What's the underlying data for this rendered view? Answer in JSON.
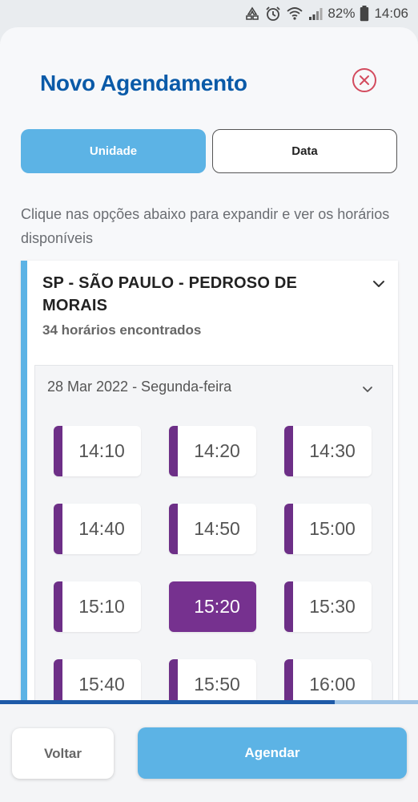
{
  "status_bar": {
    "battery": "82%",
    "time": "14:06",
    "icons": [
      "recycle-icon",
      "alarm-icon",
      "wifi-icon",
      "signal-icon",
      "battery-icon"
    ]
  },
  "header": {
    "title": "Novo Agendamento",
    "close_icon": "close-circle-icon"
  },
  "tabs": [
    {
      "label": "Unidade",
      "active": true
    },
    {
      "label": "Data",
      "active": false
    }
  ],
  "hint": "Clique nas opções abaixo para expandir e ver os horários disponíveis",
  "unit_card": {
    "title": "SP - SÃO PAULO - PEDROSO DE MORAIS",
    "count": "34 horários encontrados",
    "day": {
      "label": "28 Mar 2022 - Segunda-feira",
      "slots": [
        "14:10",
        "14:20",
        "14:30",
        "14:40",
        "14:50",
        "15:00",
        "15:10",
        "15:20",
        "15:30",
        "15:40",
        "15:50",
        "16:00"
      ],
      "selected": "15:20"
    }
  },
  "scroll_progress": 0.8,
  "footer": {
    "back_label": "Voltar",
    "submit_label": "Agendar"
  },
  "colors": {
    "brand_blue": "#0a5aa8",
    "accent_blue": "#5cb3e5",
    "slot_purple": "#6d2f87",
    "close_red": "#d34b5e"
  }
}
